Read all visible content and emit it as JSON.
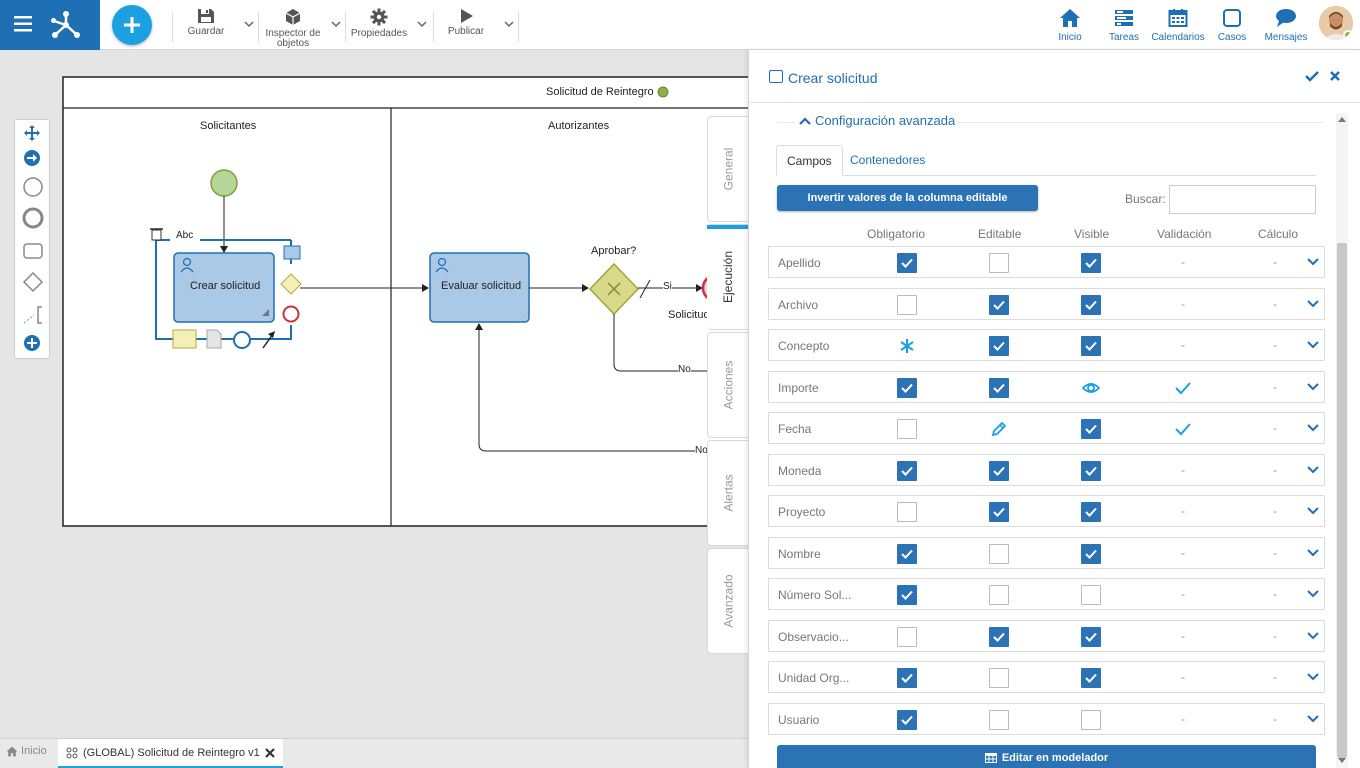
{
  "toolbar": {
    "guardar": "Guardar",
    "inspector_line1": "Inspector de",
    "inspector_line2": "objetos",
    "propiedades": "Propiedades",
    "publicar": "Publicar"
  },
  "nav": {
    "inicio": "Inicio",
    "tareas": "Tareas",
    "calendarios": "Calendarios",
    "casos": "Casos",
    "mensajes": "Mensajes"
  },
  "diagram": {
    "pool_title": "Solicitud de Reintegro",
    "lane1": "Solicitantes",
    "lane2": "Autorizantes",
    "task1": "Crear solicitud",
    "task2": "Evaluar solicitud",
    "gateway_label": "Aprobar?",
    "flow_si": "Si",
    "flow_no1": "No",
    "flow_no2": "No",
    "end_label": "Solicitud",
    "abc": "Abc"
  },
  "side_tabs": [
    "General",
    "Ejecución",
    "Acciones",
    "Alertas",
    "Avanzado"
  ],
  "bottom": {
    "home_tab": "Inicio",
    "process_tab": "(GLOBAL) Solicitud de Reintegro v1"
  },
  "panel": {
    "title": "Crear solicitud",
    "section": "Configuración avanzada",
    "tabs": [
      "Campos",
      "Contenedores"
    ],
    "invert_button": "Invertir valores de la columna editable",
    "search_label": "Buscar:",
    "search_value": "",
    "columns": [
      "Obligatorio",
      "Editable",
      "Visible",
      "Validación",
      "Cálculo"
    ],
    "rows": [
      {
        "name": "Apellido",
        "obligatorio": "on",
        "editable": "off",
        "visible": "on",
        "validacion": "-",
        "calculo": "-"
      },
      {
        "name": "Archivo",
        "obligatorio": "off",
        "editable": "on",
        "visible": "on",
        "validacion": "-",
        "calculo": "-"
      },
      {
        "name": "Concepto",
        "obligatorio": "asterisk",
        "editable": "on",
        "visible": "on",
        "validacion": "-",
        "calculo": "-"
      },
      {
        "name": "Importe",
        "obligatorio": "on",
        "editable": "on",
        "visible": "eye",
        "validacion": "check",
        "calculo": "-"
      },
      {
        "name": "Fecha",
        "obligatorio": "off",
        "editable": "pencil",
        "visible": "on",
        "validacion": "check",
        "calculo": "-"
      },
      {
        "name": "Moneda",
        "obligatorio": "on",
        "editable": "on",
        "visible": "on",
        "validacion": "-",
        "calculo": "-"
      },
      {
        "name": "Proyecto",
        "obligatorio": "off",
        "editable": "on",
        "visible": "on",
        "validacion": "-",
        "calculo": "-"
      },
      {
        "name": "Nombre",
        "obligatorio": "on",
        "editable": "off",
        "visible": "on",
        "validacion": "-",
        "calculo": "-"
      },
      {
        "name": "Número Sol...",
        "obligatorio": "on",
        "editable": "off",
        "visible": "off",
        "validacion": "-",
        "calculo": "-"
      },
      {
        "name": "Observacio...",
        "obligatorio": "off",
        "editable": "on",
        "visible": "on",
        "validacion": "-",
        "calculo": "-"
      },
      {
        "name": "Unidad Org...",
        "obligatorio": "on",
        "editable": "off",
        "visible": "on",
        "validacion": "-",
        "calculo": "-"
      },
      {
        "name": "Usuario",
        "obligatorio": "on",
        "editable": "off",
        "visible": "off",
        "validacion": "-",
        "calculo": "-"
      }
    ],
    "edit_button": "Editar en modelador"
  },
  "colors": {
    "primary": "#1f6fb5",
    "accent": "#1ba1e2",
    "button": "#2c73b5"
  }
}
